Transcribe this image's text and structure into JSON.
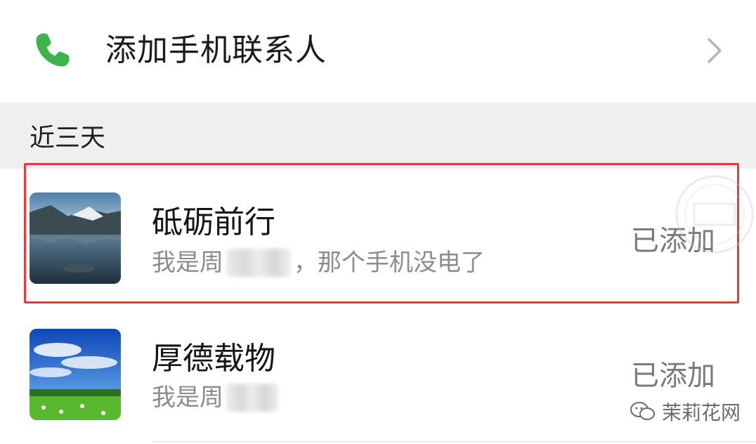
{
  "add_contacts": {
    "label": "添加手机联系人",
    "icon": "phone-icon",
    "chevron_icon": "chevron-right-icon",
    "icon_color": "#3db44a"
  },
  "section": {
    "title": "近三天"
  },
  "requests": [
    {
      "name": "砥砺前行",
      "message_prefix": "我是周",
      "message_suffix": "，那个手机没电了",
      "status": "已添加",
      "avatar": "mountain-lake-avatar"
    },
    {
      "name": "厚德载物",
      "message_prefix": "我是周",
      "message_suffix": "",
      "status": "已添加",
      "avatar": "blue-sky-meadow-avatar"
    }
  ],
  "annotation": {
    "color": "#e43a3a"
  },
  "watermark": {
    "text": "茉莉花网"
  }
}
